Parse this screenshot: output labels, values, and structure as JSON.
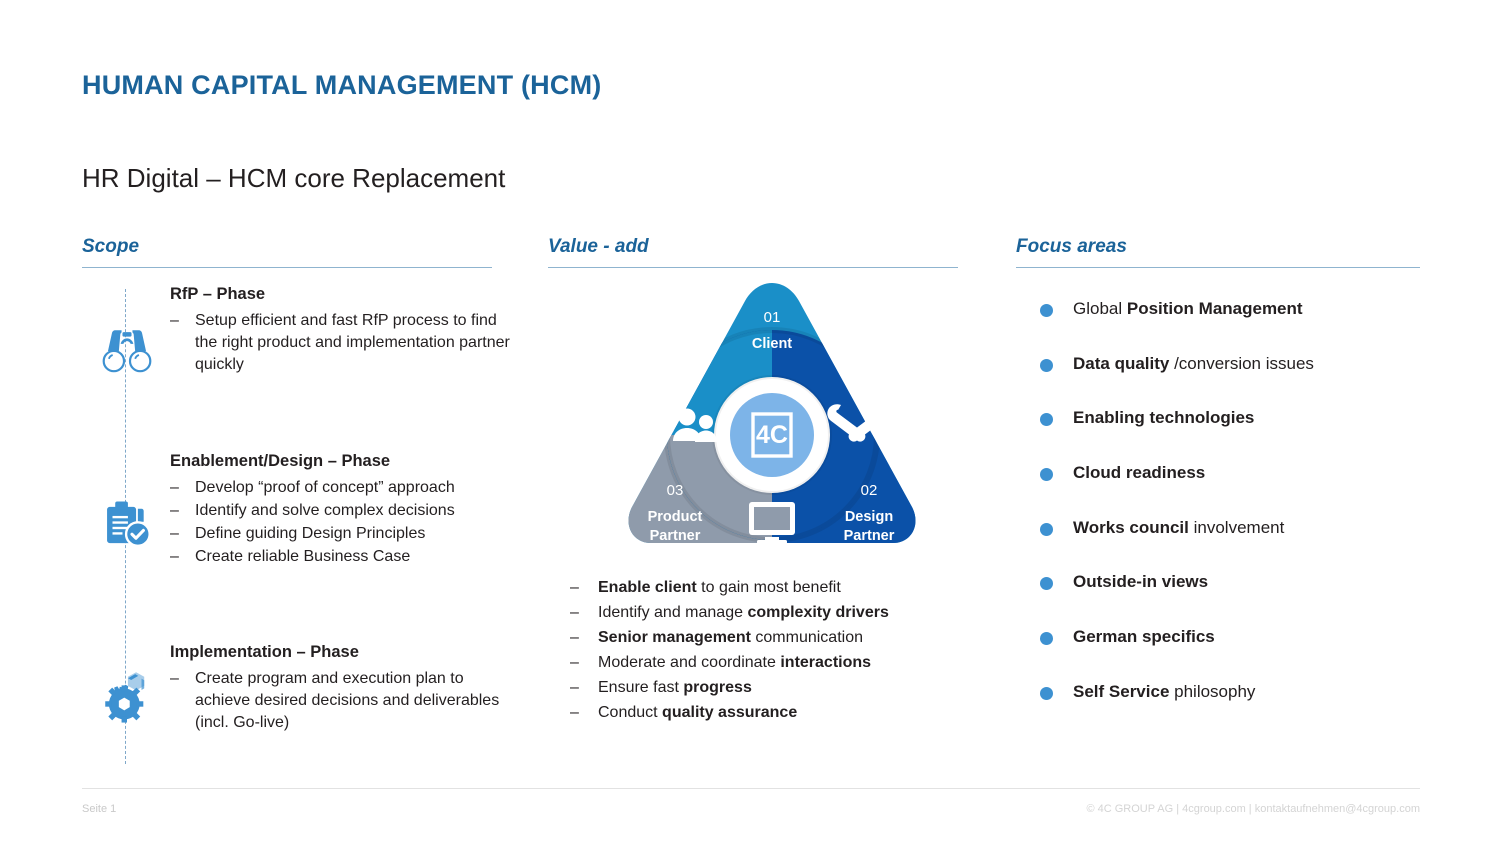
{
  "slide": {
    "title": "HUMAN CAPITAL MANAGEMENT (HCM)",
    "subtitle": "HR Digital – HCM core Replacement",
    "title_color": "#1b6399",
    "accent_color": "#3d91d1"
  },
  "columns": {
    "scope": {
      "header": "Scope"
    },
    "value": {
      "header": "Value - add"
    },
    "focus": {
      "header": "Focus areas"
    }
  },
  "scope": {
    "blocks": [
      {
        "icon": "binoculars-icon",
        "heading": "RfP – Phase",
        "items": [
          "Setup efficient and fast RfP process to find the right product and implementation partner quickly"
        ]
      },
      {
        "icon": "clipboard-check-icon",
        "heading": "Enablement/Design – Phase",
        "items": [
          "Develop “proof of concept” approach",
          "Identify and solve complex decisions",
          "Define guiding Design Principles",
          "Create reliable Business Case"
        ]
      },
      {
        "icon": "gears-icon",
        "heading": "Implementation – Phase",
        "items": [
          "Create program and execution plan to achieve desired decisions and deliverables (incl. Go-live)"
        ]
      }
    ],
    "dash_marker": "–"
  },
  "diagram": {
    "type": "triangle-venn",
    "center_logo": "4C",
    "sectors": [
      {
        "number": "01",
        "label": "Client",
        "color": "#1a8fc8",
        "position": "top",
        "icon": "people-icon"
      },
      {
        "number": "02",
        "label": "Design\nPartner",
        "label_line1": "Design",
        "label_line2": "Partner",
        "color": "#0b51a8",
        "position": "bottom-right",
        "icon": "tools-icon"
      },
      {
        "number": "03",
        "label": "Product\nPartner",
        "label_line1": "Product",
        "label_line2": "Partner",
        "color": "#8f9bab",
        "position": "bottom-left",
        "icon": "monitor-icon"
      }
    ]
  },
  "value_items": [
    {
      "parts": [
        {
          "t": "Enable client",
          "b": true
        },
        {
          "t": " to gain most benefit",
          "b": false
        }
      ]
    },
    {
      "parts": [
        {
          "t": "Identify and manage ",
          "b": false
        },
        {
          "t": "complexity drivers",
          "b": true
        }
      ]
    },
    {
      "parts": [
        {
          "t": "Senior management",
          "b": true
        },
        {
          "t": " communication",
          "b": false
        }
      ]
    },
    {
      "parts": [
        {
          "t": "Moderate and coordinate ",
          "b": false
        },
        {
          "t": "interactions",
          "b": true
        }
      ]
    },
    {
      "parts": [
        {
          "t": "Ensure fast ",
          "b": false
        },
        {
          "t": "progress",
          "b": true
        }
      ]
    },
    {
      "parts": [
        {
          "t": "Conduct ",
          "b": false
        },
        {
          "t": "quality assurance",
          "b": true
        }
      ]
    }
  ],
  "focus_items": [
    {
      "parts": [
        {
          "t": "Global ",
          "b": false
        },
        {
          "t": "Position Management",
          "b": true
        }
      ]
    },
    {
      "parts": [
        {
          "t": "Data quality",
          "b": true
        },
        {
          "t": " /conversion issues",
          "b": false
        }
      ]
    },
    {
      "parts": [
        {
          "t": "Enabling technologies",
          "b": true
        }
      ]
    },
    {
      "parts": [
        {
          "t": "Cloud readiness",
          "b": true
        }
      ]
    },
    {
      "parts": [
        {
          "t": "Works council",
          "b": true
        },
        {
          "t": " involvement",
          "b": false
        }
      ]
    },
    {
      "parts": [
        {
          "t": "Outside-in views",
          "b": true
        }
      ]
    },
    {
      "parts": [
        {
          "t": "German specifics",
          "b": true
        }
      ]
    },
    {
      "parts": [
        {
          "t": "Self Service",
          "b": true
        },
        {
          "t": " philosophy",
          "b": false
        }
      ]
    }
  ],
  "footer": {
    "left": "Seite 1",
    "right": "© 4C GROUP AG  |  4cgroup.com  |  kontaktaufnehmen@4cgroup.com"
  }
}
